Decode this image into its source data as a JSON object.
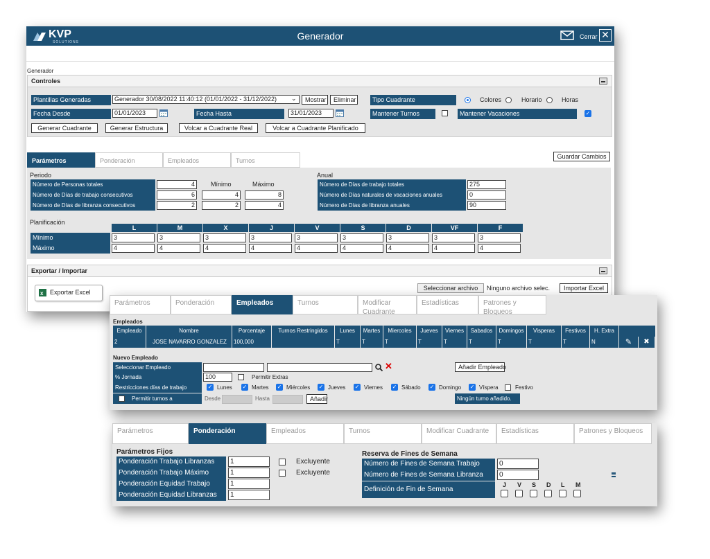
{
  "main": {
    "brand": "KVP",
    "brand_sub": "SOLUTIONS",
    "title": "Generador",
    "close_label": "Cerrar",
    "breadcrumb": "Generador",
    "controles": {
      "title": "Controles",
      "plantillas_label": "Plantillas Generadas",
      "plantillas_value": "Generador 30/08/2022 11:40:12 (01/01/2022 - 31/12/2022)",
      "mostrar": "Mostrar",
      "eliminar": "Eliminar",
      "tipo_label": "Tipo Cuadrante",
      "tipo_options": [
        "Colores",
        "Horario",
        "Horas"
      ],
      "fecha_desde_label": "Fecha Desde",
      "fecha_desde": "01/01/2023",
      "fecha_hasta_label": "Fecha Hasta",
      "fecha_hasta": "31/01/2023",
      "mantener_turnos": "Mantener Turnos",
      "mantener_vacaciones": "Mantener Vacaciones",
      "btn_generar": "Generar Cuadrante",
      "btn_estructura": "Generar Estructura",
      "btn_volcar_real": "Volcar a Cuadrante Real",
      "btn_volcar_plan": "Volcar a Cuadrante Planificado"
    },
    "tabs": [
      "Parámetros",
      "Ponderación",
      "Empleados",
      "Turnos"
    ],
    "guardar": "Guardar Cambios",
    "periodo": {
      "title": "Periodo",
      "col_min": "Mínimo",
      "col_max": "Máximo",
      "rows": [
        {
          "label": "Número de Personas totales",
          "v": "4",
          "min": "",
          "max": ""
        },
        {
          "label": "Número de Días de trabajo consecutivos",
          "v": "6",
          "min": "4",
          "max": "8"
        },
        {
          "label": "Número de Días de libranza consecutivos",
          "v": "2",
          "min": "2",
          "max": "4"
        }
      ]
    },
    "anual": {
      "title": "Anual",
      "rows": [
        {
          "label": "Número de Días de trabajo totales",
          "v": "275"
        },
        {
          "label": "Número de Días naturales de vacaciones anuales",
          "v": "0"
        },
        {
          "label": "Número de Días de libranza anuales",
          "v": "90"
        }
      ]
    },
    "planificacion": {
      "title": "Planificación",
      "days": [
        "L",
        "M",
        "X",
        "J",
        "V",
        "S",
        "D",
        "VF",
        "F"
      ],
      "row_min": "Mínimo",
      "row_max": "Máximo",
      "min_vals": [
        "3",
        "3",
        "3",
        "3",
        "3",
        "3",
        "3",
        "3",
        "3"
      ],
      "max_vals": [
        "4",
        "4",
        "4",
        "4",
        "4",
        "4",
        "4",
        "4",
        "4"
      ]
    },
    "exportar": {
      "title": "Exportar / Importar",
      "exportar_excel": "Exportar Excel",
      "seleccionar": "Seleccionar archivo",
      "ninguno": "Ninguno archivo selec.",
      "importar": "Importar Excel"
    }
  },
  "empleados_panel": {
    "tabs": [
      "Parámetros",
      "Ponderación",
      "Empleados",
      "Turnos",
      "Modificar Cuadrante",
      "Estadísticas",
      "Patrones y Bloqueos"
    ],
    "section_title": "Empleados",
    "columns": [
      "Empleado",
      "Nombre",
      "Porcentaje",
      "Turnos Restringidos",
      "Lunes",
      "Martes",
      "Miercoles",
      "Jueves",
      "Viernes",
      "Sabados",
      "Domingos",
      "Visperas",
      "Festivos",
      "H. Extra"
    ],
    "row": [
      "2",
      "JOSE NAVARRO GONZALEZ",
      "100,000",
      "",
      "T",
      "T",
      "T",
      "T",
      "T",
      "T",
      "T",
      "T",
      "T",
      "N"
    ],
    "nuevo_title": "Nuevo Empleado",
    "sel_empleado": "Seleccionar Empleado",
    "jornada": "% Jornada",
    "jornada_val": "100",
    "permitir_extras": "Permitir Extras",
    "restricciones": "Restricciones días de trabajo",
    "dias": [
      "Lunes",
      "Martes",
      "Miércoles",
      "Jueves",
      "Viernes",
      "Sábado",
      "Domingo",
      "Víspera",
      "Festivo"
    ],
    "permitir_turnos": "Permitir turnos a",
    "desde": "Desde",
    "hasta": "Hasta",
    "anadir": "Añadir",
    "anadir_empleado": "Añadir Empleado",
    "ningun_turno": "Ningún turno añadido."
  },
  "ponderacion_panel": {
    "tabs": [
      "Parámetros",
      "Ponderación",
      "Empleados",
      "Turnos",
      "Modificar Cuadrante",
      "Estadísticas",
      "Patrones y Bloqueos"
    ],
    "fijos_title": "Parámetros Fijos",
    "rows": [
      {
        "label": "Ponderación Trabajo Libranzas",
        "v": "1",
        "excl": "Excluyente"
      },
      {
        "label": "Ponderación Trabajo Máximo",
        "v": "1",
        "excl": "Excluyente"
      },
      {
        "label": "Ponderación Equidad Trabajo",
        "v": "1"
      },
      {
        "label": "Ponderación Equidad Libranzas",
        "v": "1"
      }
    ],
    "reserva_title": "Reserva de Fines de Semana",
    "fs_trabajo": "Número de Fines de Semana Trabajo",
    "fs_trabajo_v": "0",
    "fs_libranza": "Número de Fines de Semana Libranza",
    "fs_libranza_v": "0",
    "definicion": "Definición de Fin de Semana",
    "days": [
      "J",
      "V",
      "S",
      "D",
      "L",
      "M"
    ]
  }
}
